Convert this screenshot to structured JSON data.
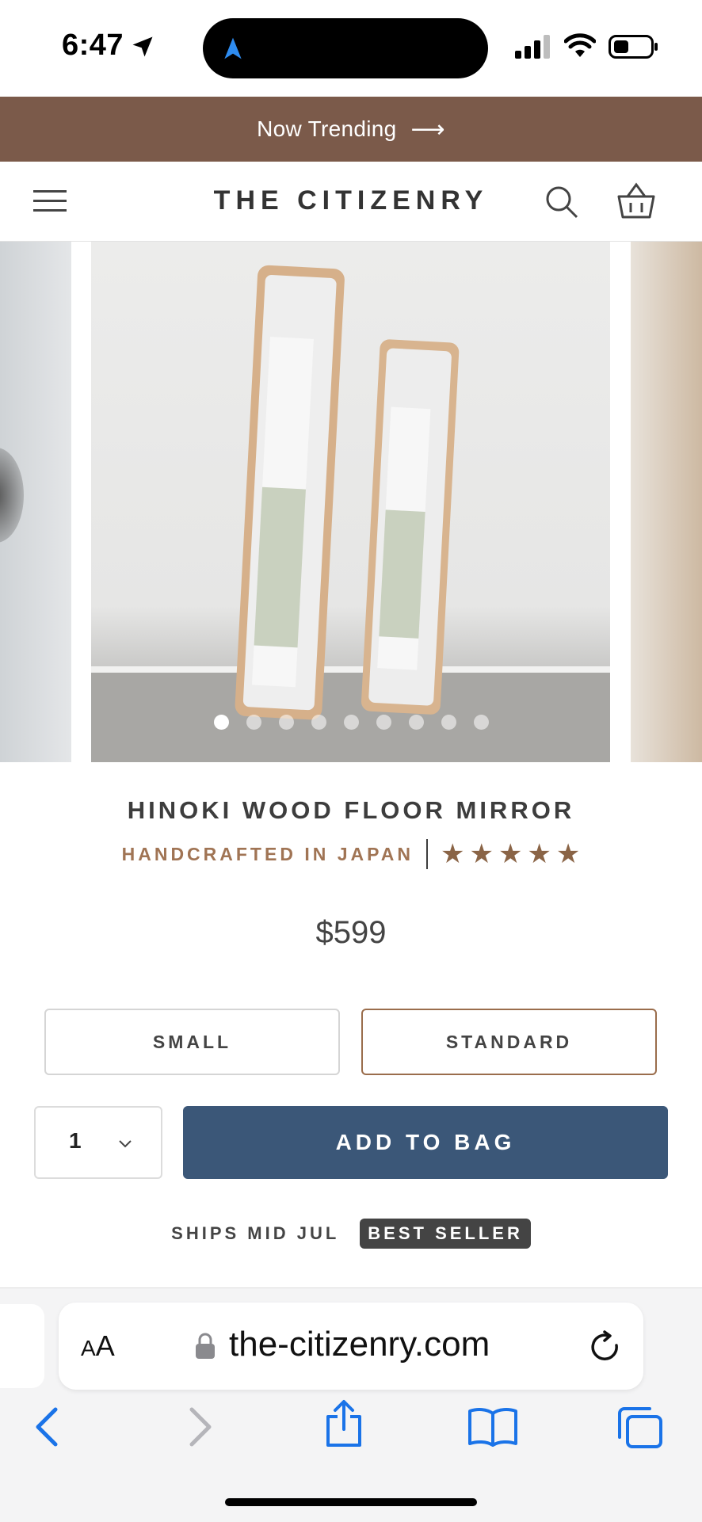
{
  "status_bar": {
    "time": "6:47"
  },
  "promo": {
    "text": "Now Trending",
    "arrow": "⟶"
  },
  "header": {
    "logo": "THE CITIZENRY",
    "menu_icon": "hamburger-menu-icon",
    "search_icon": "search-icon",
    "cart_icon": "shopping-basket-icon"
  },
  "gallery": {
    "slide_count": 9,
    "active_index": 0
  },
  "product": {
    "title": "HINOKI WOOD FLOOR MIRROR",
    "origin": "HANDCRAFTED IN JAPAN",
    "rating_stars": 5,
    "price": "$599",
    "sizes": [
      "SMALL",
      "STANDARD"
    ],
    "selected_size": "STANDARD",
    "quantity": "1",
    "add_to_bag": "ADD TO BAG",
    "ships": "SHIPS MID JUL",
    "badge": "BEST SELLER"
  },
  "browser": {
    "text_size_label_small": "A",
    "text_size_label_large": "A",
    "url": "the-citizenry.com"
  },
  "colors": {
    "promo_bg": "#7b5a4a",
    "accent_brown": "#9a6d4c",
    "add_button": "#3b5778",
    "ios_blue": "#1a73e8"
  }
}
